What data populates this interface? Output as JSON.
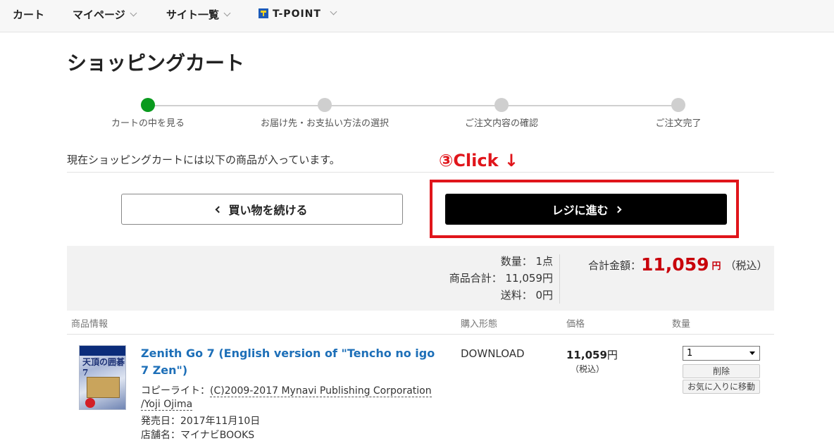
{
  "nav": {
    "cart": "カート",
    "mypage": "マイページ",
    "sitelist": "サイト一覧",
    "tpoint": "T-POINT"
  },
  "page_title": "ショッピングカート",
  "steps": [
    {
      "label": "カートの中を見る",
      "active": true
    },
    {
      "label": "お届け先・お支払い方法の選択",
      "active": false
    },
    {
      "label": "ご注文内容の確認",
      "active": false
    },
    {
      "label": "ご注文完了",
      "active": false
    }
  ],
  "cart_message": "現在ショッピングカートには以下の商品が入っています。",
  "annotation": "③Click ↓",
  "buttons": {
    "continue": "買い物を続ける",
    "checkout": "レジに進む"
  },
  "summary": {
    "quantity": "数量： 1点",
    "subtotal": "商品合計： 11,059円",
    "shipping": "送料： 0円",
    "total_label": "合計金額：",
    "total_value": "11,059",
    "total_unit": "円",
    "tax_note": "（税込）"
  },
  "table_headers": {
    "info": "商品情報",
    "type": "購入形態",
    "price": "価格",
    "qty": "数量"
  },
  "item": {
    "name": "Zenith Go 7 (English version of \"Tencho no igo 7 Zen\")",
    "copyright_label": "コピーライト：",
    "copyright_line1": "(C)2009-2017 Mynavi Publishing Corporation",
    "copyright_line2": "/Yoji Ojima",
    "release": "発売日：2017年11月10日",
    "store": "店舗名：マイナビBOOKS",
    "purchase_type": "DOWNLOAD",
    "price": "11,059",
    "price_unit": "円",
    "price_tax": "（税込）",
    "qty_selected": "1",
    "delete": "削除",
    "favorite": "お気に入りに移動",
    "image_title": "天頂の囲碁7"
  }
}
